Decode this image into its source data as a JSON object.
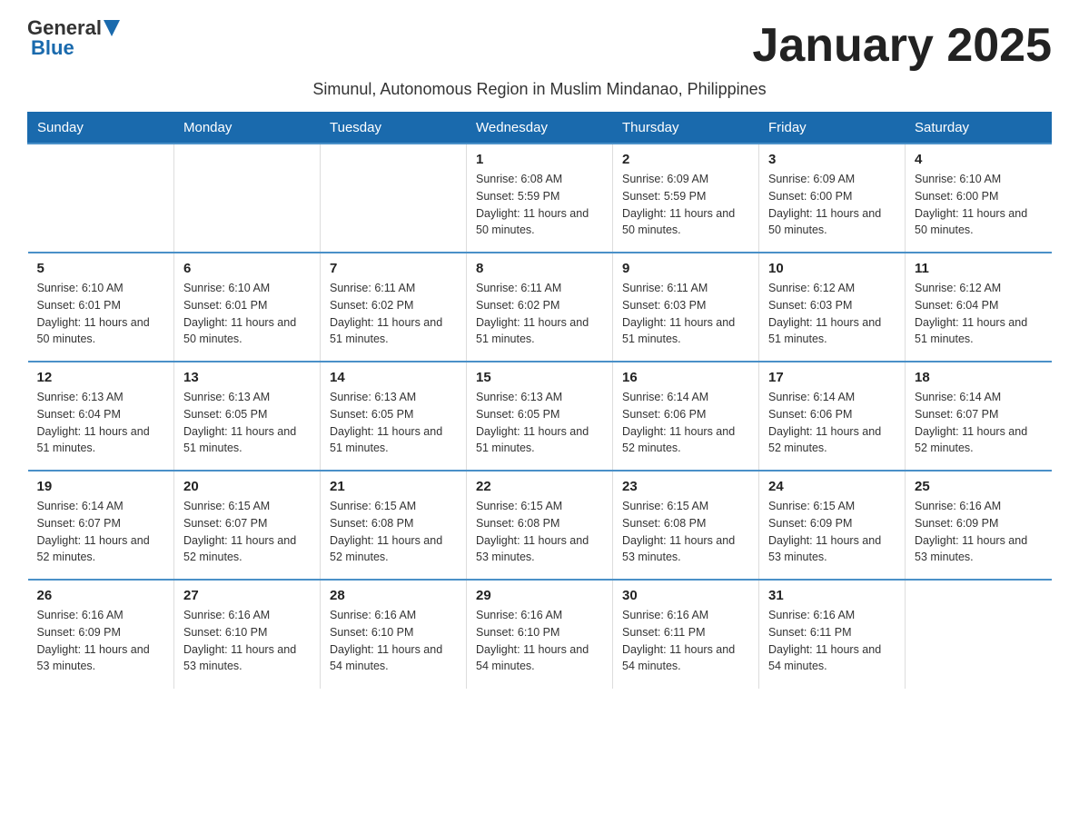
{
  "logo": {
    "general": "General",
    "blue": "Blue"
  },
  "title": "January 2025",
  "subtitle": "Simunul, Autonomous Region in Muslim Mindanao, Philippines",
  "weekdays": [
    "Sunday",
    "Monday",
    "Tuesday",
    "Wednesday",
    "Thursday",
    "Friday",
    "Saturday"
  ],
  "weeks": [
    [
      {
        "day": "",
        "info": ""
      },
      {
        "day": "",
        "info": ""
      },
      {
        "day": "",
        "info": ""
      },
      {
        "day": "1",
        "info": "Sunrise: 6:08 AM\nSunset: 5:59 PM\nDaylight: 11 hours and 50 minutes."
      },
      {
        "day": "2",
        "info": "Sunrise: 6:09 AM\nSunset: 5:59 PM\nDaylight: 11 hours and 50 minutes."
      },
      {
        "day": "3",
        "info": "Sunrise: 6:09 AM\nSunset: 6:00 PM\nDaylight: 11 hours and 50 minutes."
      },
      {
        "day": "4",
        "info": "Sunrise: 6:10 AM\nSunset: 6:00 PM\nDaylight: 11 hours and 50 minutes."
      }
    ],
    [
      {
        "day": "5",
        "info": "Sunrise: 6:10 AM\nSunset: 6:01 PM\nDaylight: 11 hours and 50 minutes."
      },
      {
        "day": "6",
        "info": "Sunrise: 6:10 AM\nSunset: 6:01 PM\nDaylight: 11 hours and 50 minutes."
      },
      {
        "day": "7",
        "info": "Sunrise: 6:11 AM\nSunset: 6:02 PM\nDaylight: 11 hours and 51 minutes."
      },
      {
        "day": "8",
        "info": "Sunrise: 6:11 AM\nSunset: 6:02 PM\nDaylight: 11 hours and 51 minutes."
      },
      {
        "day": "9",
        "info": "Sunrise: 6:11 AM\nSunset: 6:03 PM\nDaylight: 11 hours and 51 minutes."
      },
      {
        "day": "10",
        "info": "Sunrise: 6:12 AM\nSunset: 6:03 PM\nDaylight: 11 hours and 51 minutes."
      },
      {
        "day": "11",
        "info": "Sunrise: 6:12 AM\nSunset: 6:04 PM\nDaylight: 11 hours and 51 minutes."
      }
    ],
    [
      {
        "day": "12",
        "info": "Sunrise: 6:13 AM\nSunset: 6:04 PM\nDaylight: 11 hours and 51 minutes."
      },
      {
        "day": "13",
        "info": "Sunrise: 6:13 AM\nSunset: 6:05 PM\nDaylight: 11 hours and 51 minutes."
      },
      {
        "day": "14",
        "info": "Sunrise: 6:13 AM\nSunset: 6:05 PM\nDaylight: 11 hours and 51 minutes."
      },
      {
        "day": "15",
        "info": "Sunrise: 6:13 AM\nSunset: 6:05 PM\nDaylight: 11 hours and 51 minutes."
      },
      {
        "day": "16",
        "info": "Sunrise: 6:14 AM\nSunset: 6:06 PM\nDaylight: 11 hours and 52 minutes."
      },
      {
        "day": "17",
        "info": "Sunrise: 6:14 AM\nSunset: 6:06 PM\nDaylight: 11 hours and 52 minutes."
      },
      {
        "day": "18",
        "info": "Sunrise: 6:14 AM\nSunset: 6:07 PM\nDaylight: 11 hours and 52 minutes."
      }
    ],
    [
      {
        "day": "19",
        "info": "Sunrise: 6:14 AM\nSunset: 6:07 PM\nDaylight: 11 hours and 52 minutes."
      },
      {
        "day": "20",
        "info": "Sunrise: 6:15 AM\nSunset: 6:07 PM\nDaylight: 11 hours and 52 minutes."
      },
      {
        "day": "21",
        "info": "Sunrise: 6:15 AM\nSunset: 6:08 PM\nDaylight: 11 hours and 52 minutes."
      },
      {
        "day": "22",
        "info": "Sunrise: 6:15 AM\nSunset: 6:08 PM\nDaylight: 11 hours and 53 minutes."
      },
      {
        "day": "23",
        "info": "Sunrise: 6:15 AM\nSunset: 6:08 PM\nDaylight: 11 hours and 53 minutes."
      },
      {
        "day": "24",
        "info": "Sunrise: 6:15 AM\nSunset: 6:09 PM\nDaylight: 11 hours and 53 minutes."
      },
      {
        "day": "25",
        "info": "Sunrise: 6:16 AM\nSunset: 6:09 PM\nDaylight: 11 hours and 53 minutes."
      }
    ],
    [
      {
        "day": "26",
        "info": "Sunrise: 6:16 AM\nSunset: 6:09 PM\nDaylight: 11 hours and 53 minutes."
      },
      {
        "day": "27",
        "info": "Sunrise: 6:16 AM\nSunset: 6:10 PM\nDaylight: 11 hours and 53 minutes."
      },
      {
        "day": "28",
        "info": "Sunrise: 6:16 AM\nSunset: 6:10 PM\nDaylight: 11 hours and 54 minutes."
      },
      {
        "day": "29",
        "info": "Sunrise: 6:16 AM\nSunset: 6:10 PM\nDaylight: 11 hours and 54 minutes."
      },
      {
        "day": "30",
        "info": "Sunrise: 6:16 AM\nSunset: 6:11 PM\nDaylight: 11 hours and 54 minutes."
      },
      {
        "day": "31",
        "info": "Sunrise: 6:16 AM\nSunset: 6:11 PM\nDaylight: 11 hours and 54 minutes."
      },
      {
        "day": "",
        "info": ""
      }
    ]
  ]
}
